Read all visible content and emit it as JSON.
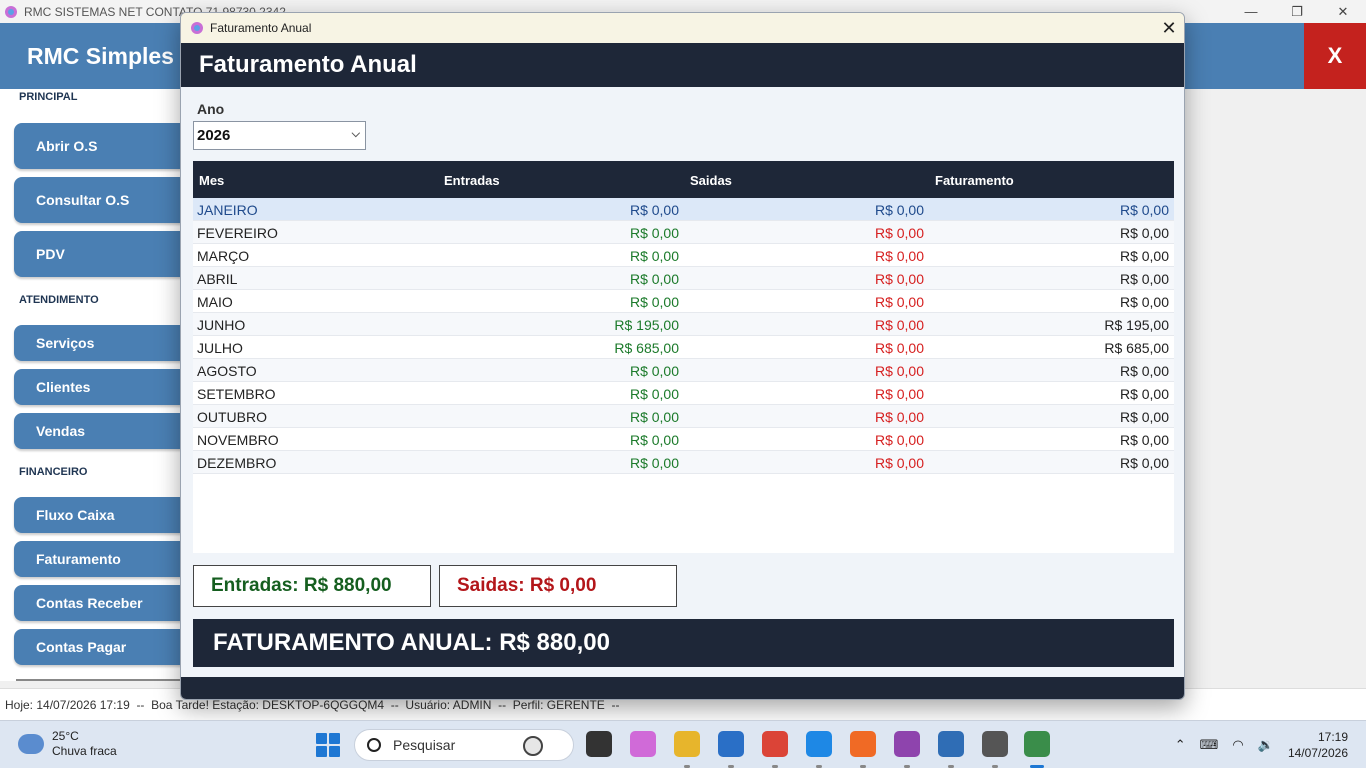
{
  "main_window": {
    "title": "RMC SISTEMAS NET CONTATO 71 98730 2342",
    "brand": "RMC Simples",
    "close_label": "X"
  },
  "sidebar": {
    "sections": [
      {
        "title": "PRINCIPAL",
        "items": [
          "Abrir O.S",
          "Consultar O.S",
          "PDV"
        ]
      },
      {
        "title": "ATENDIMENTO",
        "items": [
          "Serviços",
          "Clientes",
          "Vendas"
        ]
      },
      {
        "title": "FINANCEIRO",
        "items": [
          "Fluxo Caixa",
          "Faturamento",
          "Contas Receber",
          "Contas Pagar"
        ]
      }
    ]
  },
  "statusbar": {
    "text": "Hoje: 14/07/2026 17:19  --  Boa Tarde! Estação: DESKTOP-6QGGQM4  --  Usuário: ADMIN  --  Perfil: GERENTE  --"
  },
  "dialog": {
    "window_title": "Faturamento Anual",
    "header": "Faturamento Anual",
    "year_label": "Ano",
    "year_value": "2026",
    "columns": [
      "Mes",
      "Entradas",
      "Saidas",
      "Faturamento"
    ],
    "rows": [
      {
        "mes": "JANEIRO",
        "entradas": "R$ 0,00",
        "saidas": "R$ 0,00",
        "faturamento": "R$ 0,00"
      },
      {
        "mes": "FEVEREIRO",
        "entradas": "R$ 0,00",
        "saidas": "R$ 0,00",
        "faturamento": "R$ 0,00"
      },
      {
        "mes": "MARÇO",
        "entradas": "R$ 0,00",
        "saidas": "R$ 0,00",
        "faturamento": "R$ 0,00"
      },
      {
        "mes": "ABRIL",
        "entradas": "R$ 0,00",
        "saidas": "R$ 0,00",
        "faturamento": "R$ 0,00"
      },
      {
        "mes": "MAIO",
        "entradas": "R$ 0,00",
        "saidas": "R$ 0,00",
        "faturamento": "R$ 0,00"
      },
      {
        "mes": "JUNHO",
        "entradas": "R$ 195,00",
        "saidas": "R$ 0,00",
        "faturamento": "R$ 195,00"
      },
      {
        "mes": "JULHO",
        "entradas": "R$ 685,00",
        "saidas": "R$ 0,00",
        "faturamento": "R$ 685,00"
      },
      {
        "mes": "AGOSTO",
        "entradas": "R$ 0,00",
        "saidas": "R$ 0,00",
        "faturamento": "R$ 0,00"
      },
      {
        "mes": "SETEMBRO",
        "entradas": "R$ 0,00",
        "saidas": "R$ 0,00",
        "faturamento": "R$ 0,00"
      },
      {
        "mes": "OUTUBRO",
        "entradas": "R$ 0,00",
        "saidas": "R$ 0,00",
        "faturamento": "R$ 0,00"
      },
      {
        "mes": "NOVEMBRO",
        "entradas": "R$ 0,00",
        "saidas": "R$ 0,00",
        "faturamento": "R$ 0,00"
      },
      {
        "mes": "DEZEMBRO",
        "entradas": "R$ 0,00",
        "saidas": "R$ 0,00",
        "faturamento": "R$ 0,00"
      }
    ],
    "selected_row": "JANEIRO",
    "total_entradas": "Entradas: R$ 880,00",
    "total_saidas": "Saidas: R$ 0,00",
    "faturamento_anual": "FATURAMENTO ANUAL: R$ 880,00"
  },
  "taskbar": {
    "weather_temp": "25°C",
    "weather_desc": "Chuva fraca",
    "search_placeholder": "Pesquisar",
    "time": "17:19",
    "date": "14/07/2026",
    "apps": [
      "task-view-icon",
      "copilot-icon",
      "file-explorer-icon",
      "microsoft-store-icon",
      "chrome-icon",
      "vscode-icon",
      "firefox-icon",
      "visual-studio-icon",
      "notepad-icon",
      "settings-icon",
      "rmc-app-icon"
    ]
  },
  "colors": {
    "accent": "#4a7fb3",
    "dark": "#1e2738",
    "green": "#1b7a2a",
    "red": "#d61f1f",
    "close_red": "#c4221e"
  }
}
